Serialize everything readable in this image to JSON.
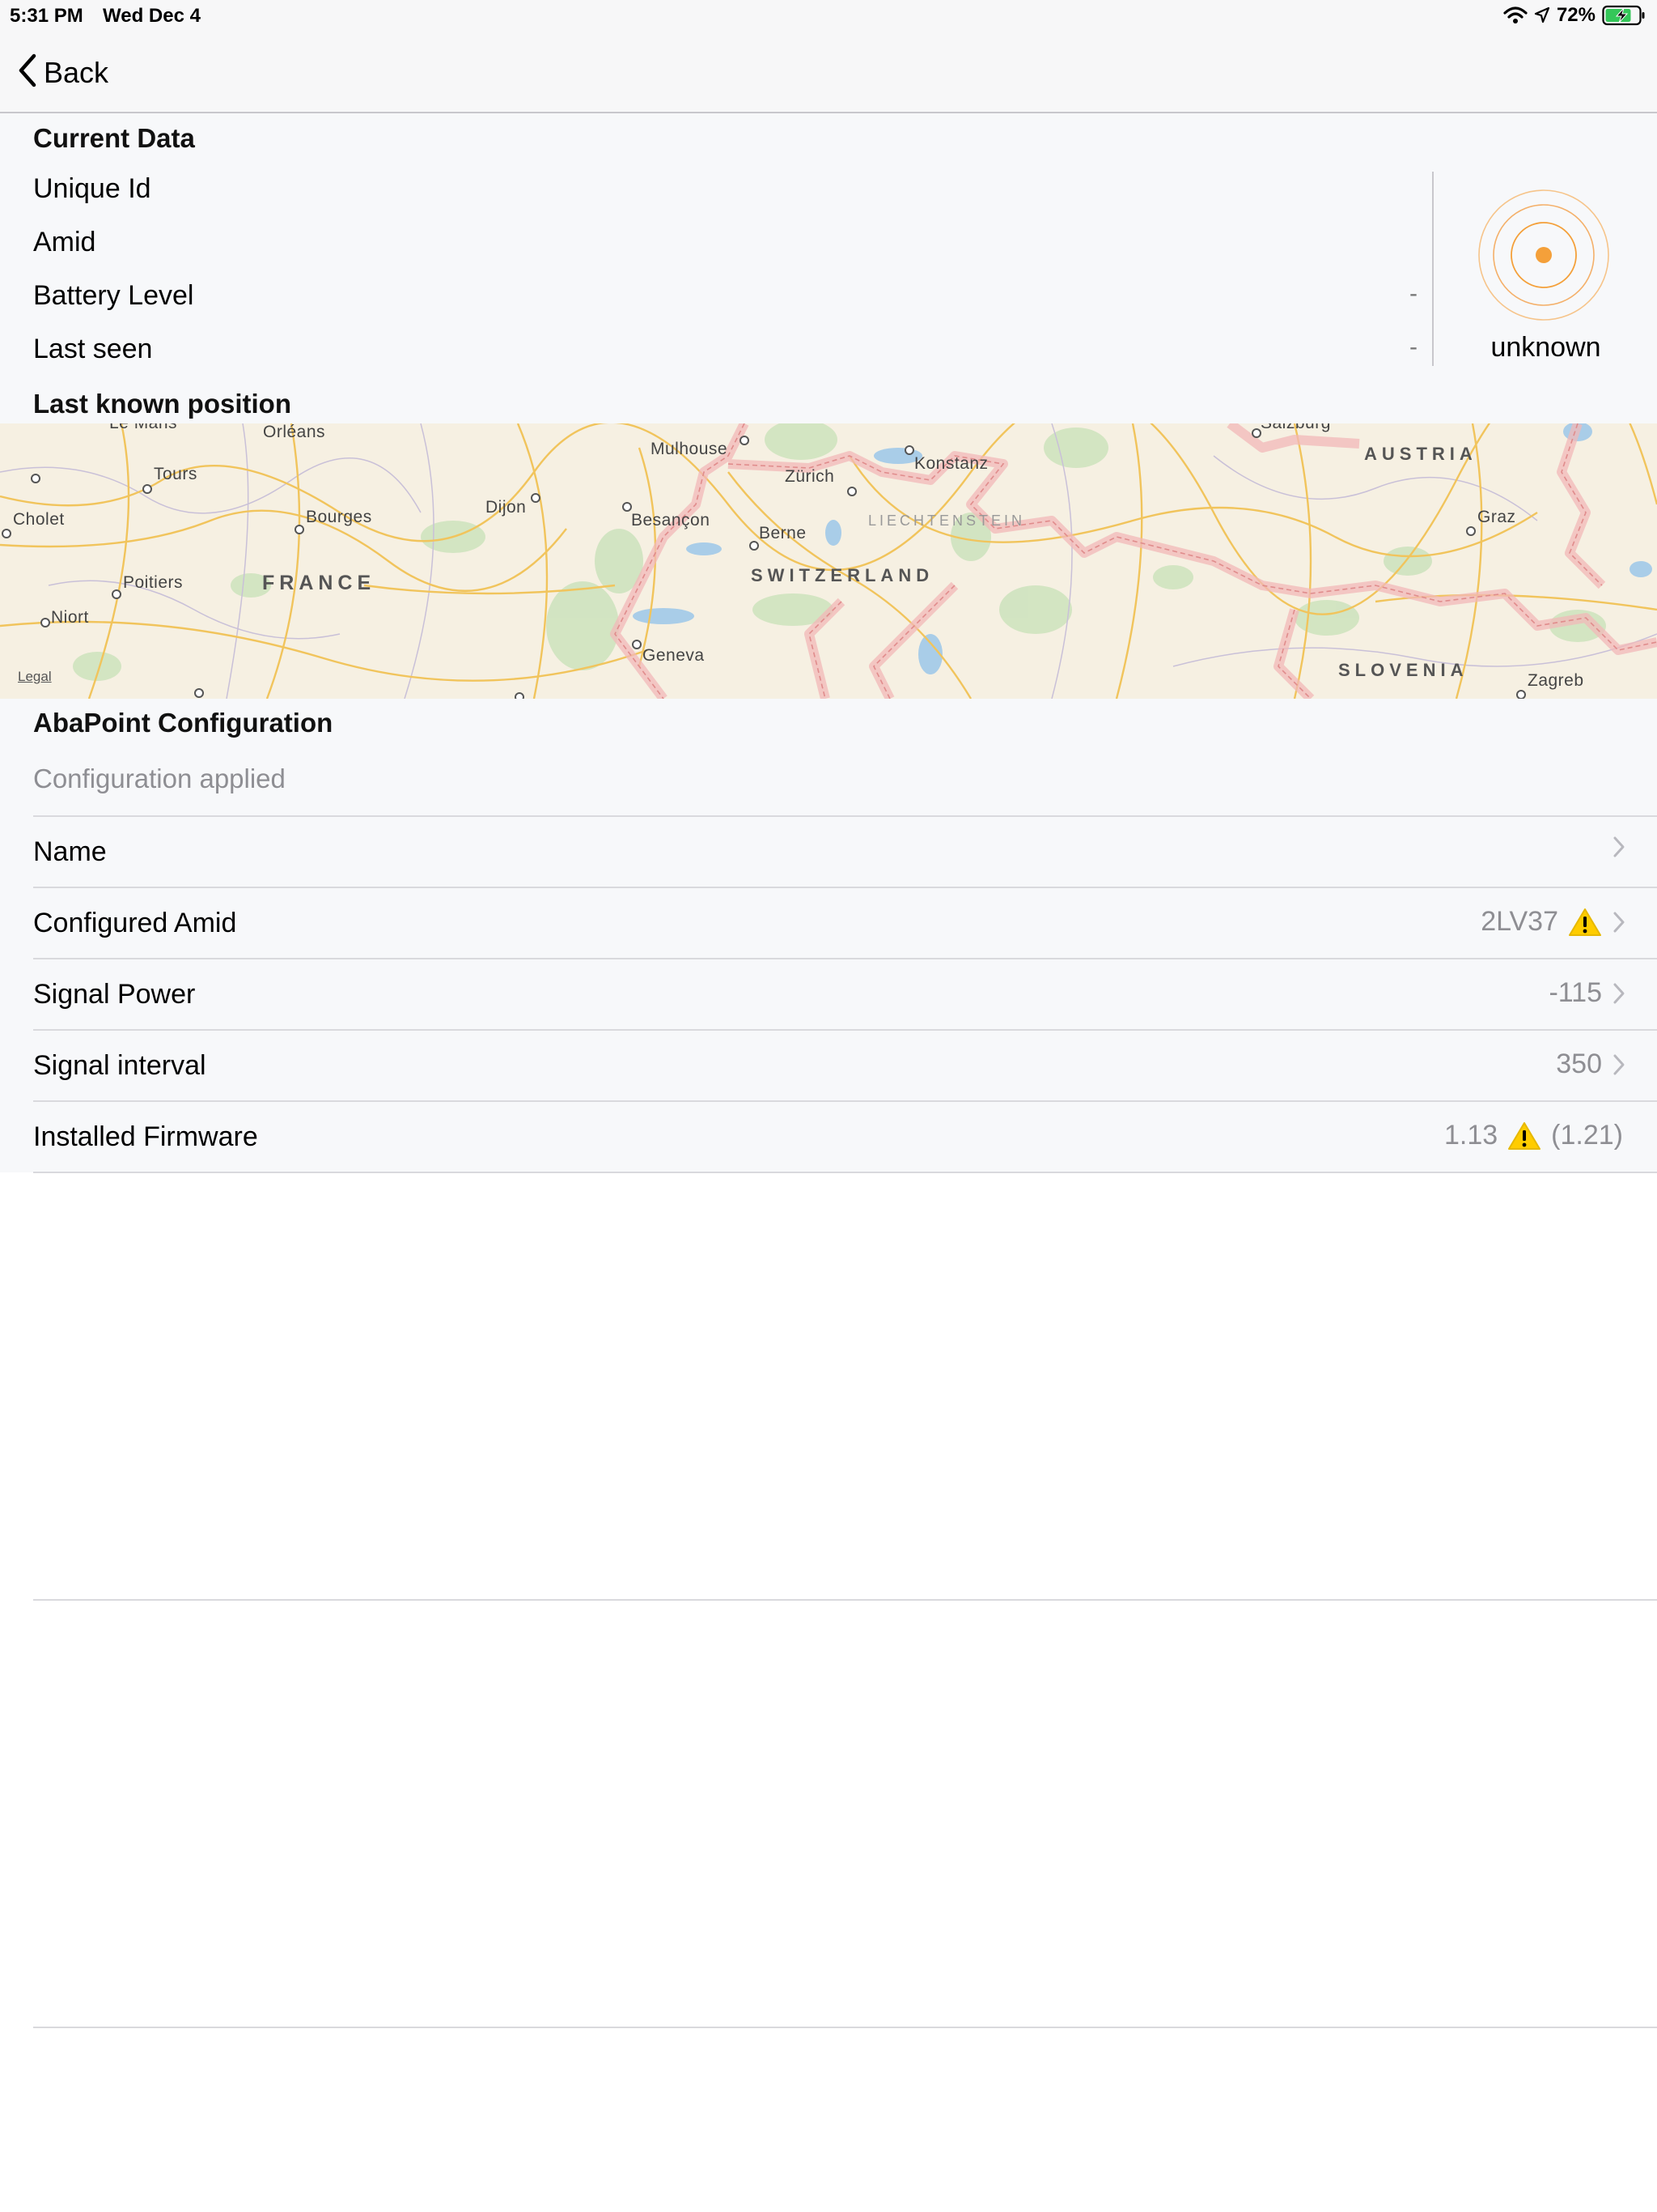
{
  "status_bar": {
    "time": "5:31 PM",
    "date": "Wed Dec 4",
    "battery": "72%"
  },
  "nav": {
    "back_label": "Back"
  },
  "current_data": {
    "header": "Current Data",
    "rows": [
      {
        "label": "Unique Id",
        "value": ""
      },
      {
        "label": "Amid",
        "value": ""
      },
      {
        "label": "Battery Level",
        "value": "-"
      },
      {
        "label": "Last seen",
        "value": "-"
      }
    ],
    "beacon_status": "unknown"
  },
  "last_known_position": {
    "header": "Last known position",
    "legal": "Legal",
    "cities": [
      "Orléans",
      "Tours",
      "Cholet",
      "Bourges",
      "Poitiers",
      "Niort",
      "Dijon",
      "Besançon",
      "Mulhouse",
      "Zürich",
      "Konstanz",
      "Berne",
      "Geneva",
      "Graz",
      "Zagreb",
      "Salzburg",
      "Le Mans"
    ],
    "countries": [
      "FRANCE",
      "SWITZERLAND",
      "LIECHTENSTEIN",
      "AUSTRIA",
      "SLOVENIA"
    ]
  },
  "config": {
    "header": "AbaPoint Configuration",
    "caption": "Configuration applied",
    "rows": [
      {
        "label": "Name",
        "value": "",
        "warning": false,
        "chevron": true
      },
      {
        "label": "Configured Amid",
        "value": "2LV37",
        "warning": true,
        "chevron": true
      },
      {
        "label": "Signal Power",
        "value": "-115",
        "warning": false,
        "chevron": true
      },
      {
        "label": "Signal interval",
        "value": "350",
        "warning": false,
        "chevron": true
      },
      {
        "label": "Installed Firmware",
        "value": "1.13",
        "warning": true,
        "suffix": "(1.21)",
        "chevron": false
      }
    ]
  },
  "colors": {
    "accent_orange": "#f4a03a",
    "warning_yellow": "#ffcc00",
    "border_red": "#e8a0a0"
  }
}
